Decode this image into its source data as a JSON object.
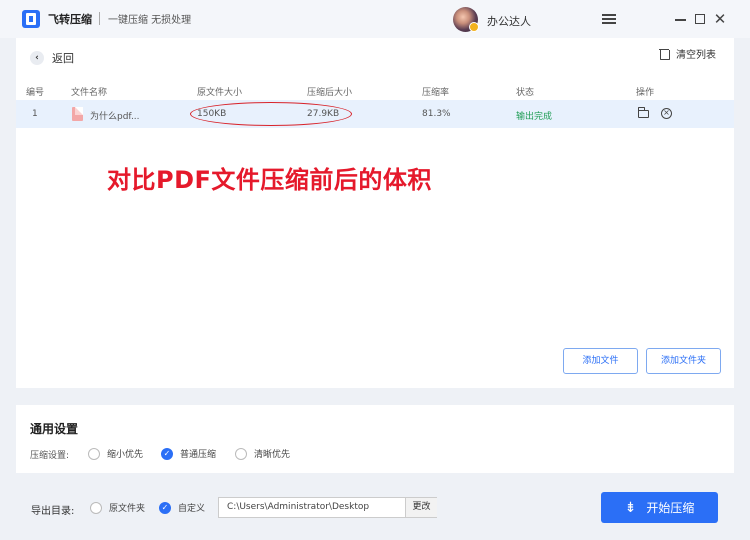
{
  "titlebar": {
    "app_name": "飞转压缩",
    "slogan": "一键压缩 无损处理",
    "user_name": "办公达人"
  },
  "toolbar": {
    "back_label": "返回",
    "clear_label": "清空列表"
  },
  "table": {
    "columns": [
      "编号",
      "文件名称",
      "原文件大小",
      "压缩后大小",
      "压缩率",
      "状态",
      "操作"
    ],
    "rows": [
      {
        "index": "1",
        "file_name": "为什么pdf...",
        "original_size": "150KB",
        "compressed_size": "27.9KB",
        "ratio": "81.3%",
        "status": "输出完成"
      }
    ]
  },
  "annotation_text": "对比PDF文件压缩前后的体积",
  "actions": {
    "add_file": "添加文件",
    "add_folder": "添加文件夹"
  },
  "settings": {
    "title": "通用设置",
    "compress_label": "压缩设置:",
    "options": [
      "缩小优先",
      "普通压缩",
      "清晰优先"
    ],
    "selected": "普通压缩"
  },
  "export": {
    "label": "导出目录:",
    "options": [
      "原文件夹",
      "自定义"
    ],
    "selected": "自定义",
    "path": "C:\\Users\\Administrator\\Desktop",
    "change_label": "更改"
  },
  "start_label": "开始压缩",
  "colors": {
    "accent": "#2b6ff6",
    "status_done": "#1f9d55",
    "annotation": "#e5192b",
    "row_highlight": "#e8f1fd"
  }
}
